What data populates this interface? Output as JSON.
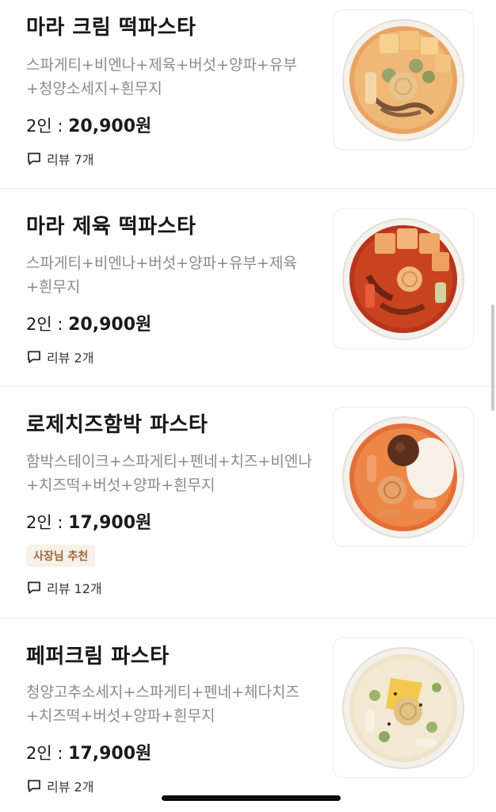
{
  "menu_items": [
    {
      "name": "마라 크림 떡파스타",
      "description": "스파게티+비엔나+제육+버섯+양파+유부+청양소세지+흰무지",
      "price_prefix": "2인 : ",
      "price": "20,900원",
      "review": "리뷰 7개",
      "image_icon": "mala-cream-tteok-pasta-image"
    },
    {
      "name": "마라 제육 떡파스타",
      "description": "스파게티+비엔나+버섯+양파+유부+제육+흰무지",
      "price_prefix": "2인 : ",
      "price": "20,900원",
      "review": "리뷰 2개",
      "image_icon": "mala-jeyuk-tteok-pasta-image"
    },
    {
      "name": "로제치즈함박 파스타",
      "description": "함박스테이크+스파게티+펜네+치즈+비엔나+치즈떡+버섯+양파+흰무지",
      "price_prefix": "2인 : ",
      "price": "17,900원",
      "badge": "사장님 추천",
      "review": "리뷰 12개",
      "image_icon": "rose-cheese-hamburg-pasta-image"
    },
    {
      "name": "페퍼크림 파스타",
      "description": "청양고추소세지+스파게티+펜네+체다치즈+치즈떡+버섯+양파+흰무지",
      "price_prefix": "2인 : ",
      "price": "17,900원",
      "review": "리뷰 2개",
      "image_icon": "pepper-cream-pasta-image"
    }
  ],
  "colors": {
    "badge_bg": "#f7f1ea",
    "badge_text": "#a0673a",
    "description": "#8a8a8a",
    "divider": "#ececec"
  },
  "icons": {
    "review": "speech-bubble-icon"
  }
}
